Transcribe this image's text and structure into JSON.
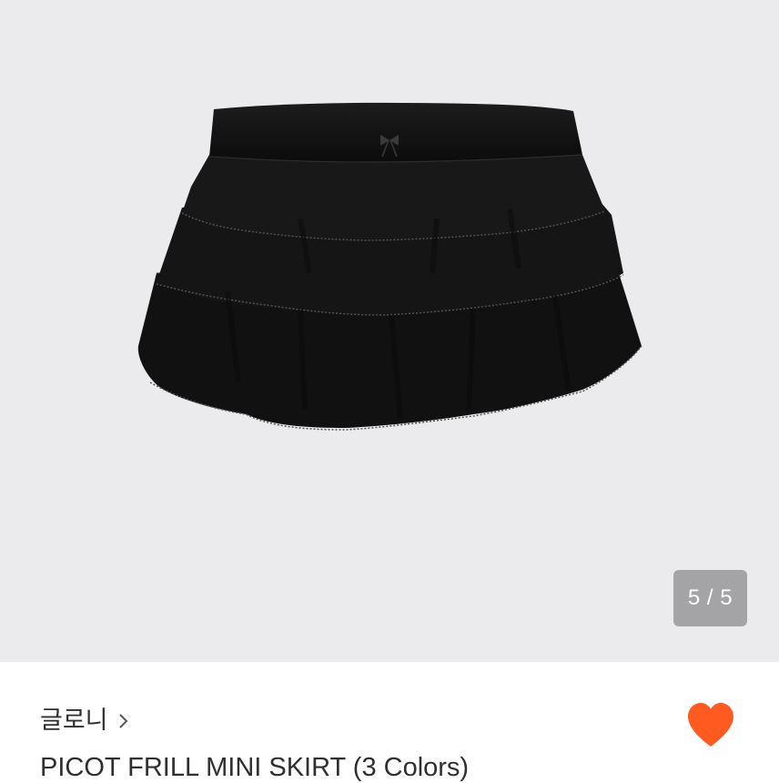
{
  "gallery": {
    "current": 5,
    "total": 5,
    "counter_text": "5 / 5",
    "image_alt": "black tiered ruffle mini skirt"
  },
  "product": {
    "store_name": "글로니",
    "title": "PICOT FRILL MINI SKIRT (3 Colors)",
    "liked": true
  },
  "icons": {
    "store_link": "chevron-right-icon",
    "like": "heart-icon"
  },
  "colors": {
    "image_background": "#ebebed",
    "counter_background": "#a4a4a6",
    "heart": "#ff5a1f",
    "text": "#2f2f2f"
  }
}
